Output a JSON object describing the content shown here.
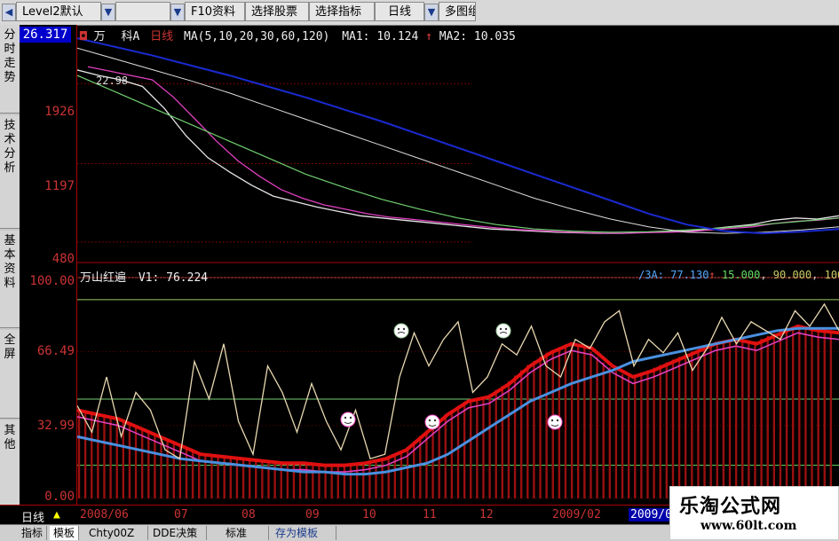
{
  "toolbar": {
    "level2": "Level2默认",
    "f10": "F10资料",
    "select_stock": "选择股票",
    "select_indicator": "选择指标",
    "period": "日线",
    "multi": "多图组"
  },
  "left_tabs": [
    "分时走势",
    "技术分析",
    "基本资料",
    "全屏",
    "其他"
  ],
  "price_box": "26.317",
  "top_panel": {
    "title_prefix": "万",
    "title_mid": "科A",
    "period": "日线",
    "ma_params": "MA(5,10,20,30,60,120)",
    "ma1": "MA1: 10.124",
    "ma2": "MA2: 10.035",
    "ann_price": "22.98",
    "yticks": [
      "1926",
      "1197",
      "480"
    ]
  },
  "bottom_panel": {
    "indicator": "万山红遍",
    "v1": "V1: 76.224",
    "right_values": [
      "/3A: 77.130",
      "15.000",
      "90.000",
      "100"
    ],
    "yticks": [
      "100.00",
      "66.49",
      "32.99",
      "0.00"
    ]
  },
  "date_strip": {
    "period": "日线",
    "dates": [
      "2008/06",
      "07",
      "08",
      "09",
      "10",
      "11",
      "12",
      "2009/02",
      "2009/0"
    ]
  },
  "bottom_tabs": [
    "指标",
    "模板",
    "Chty00Z",
    "DDE决策",
    "标准",
    "存为模板"
  ],
  "watermark": {
    "name": "乐淘公式网",
    "url": "www.60lt.com"
  },
  "colors": {
    "up": "#c83232",
    "ma_white": "#e6e6e6",
    "ma_pink": "#e040c0",
    "ma_green": "#70d070",
    "ma_blue": "#1a2ad0",
    "indicator_red": "#e01010",
    "indicator_blue": "#4a90e0"
  },
  "chart_data": [
    {
      "type": "line",
      "panel": "price",
      "ylim": [
        480,
        2300
      ],
      "y_ticks": [
        1926,
        1197,
        480
      ],
      "series": [
        {
          "name": "MA1",
          "values": [
            2050,
            2000,
            1960,
            1900,
            1700,
            1450,
            1250,
            1120,
            1000,
            900,
            850,
            800,
            760,
            720,
            700,
            680,
            660,
            640,
            620,
            600,
            590,
            580,
            570,
            565,
            560,
            560,
            570,
            575,
            580,
            600,
            620,
            640,
            680,
            700,
            690,
            720
          ]
        },
        {
          "name": "MA2",
          "values": [
            2080,
            2040,
            2000,
            1960,
            1800,
            1600,
            1400,
            1220,
            1080,
            960,
            880,
            820,
            780,
            740,
            710,
            690,
            670,
            650,
            630,
            610,
            595,
            585,
            575,
            568,
            562,
            560,
            566,
            570,
            575,
            590,
            605,
            620,
            650,
            670,
            680,
            700
          ]
        }
      ]
    },
    {
      "type": "line",
      "panel": "indicator",
      "ylim": [
        0,
        100
      ],
      "y_ticks": [
        100.0,
        66.49,
        32.99,
        0.0
      ],
      "hlines": [
        15.0,
        90.0,
        100.0
      ],
      "series": [
        {
          "name": "V1",
          "values": [
            42,
            30,
            55,
            28,
            48,
            40,
            22,
            18,
            62,
            45,
            70,
            35,
            20,
            60,
            48,
            30,
            52,
            35,
            22,
            40,
            18,
            20,
            55,
            75,
            60,
            72,
            80,
            48,
            55,
            70,
            65,
            78,
            60,
            55,
            72,
            68,
            80,
            85,
            60,
            72,
            66,
            75,
            58,
            68,
            82,
            70,
            80,
            76,
            72,
            85,
            78,
            88,
            76
          ]
        },
        {
          "name": "red_band",
          "values": [
            40,
            38,
            36,
            32,
            28,
            24,
            20,
            19,
            18,
            17,
            16,
            16,
            15,
            15,
            16,
            18,
            22,
            30,
            38,
            44,
            46,
            52,
            60,
            66,
            70,
            68,
            60,
            55,
            58,
            62,
            66,
            70,
            72,
            70,
            74,
            78,
            76,
            75
          ]
        },
        {
          "name": "blue_band",
          "values": [
            28,
            26,
            24,
            22,
            20,
            18,
            17,
            16,
            15,
            14,
            13,
            12,
            12,
            11,
            11,
            12,
            14,
            16,
            20,
            26,
            32,
            38,
            44,
            48,
            52,
            55,
            58,
            62,
            64,
            66,
            68,
            70,
            72,
            74,
            76,
            77,
            77,
            77
          ]
        }
      ]
    }
  ]
}
